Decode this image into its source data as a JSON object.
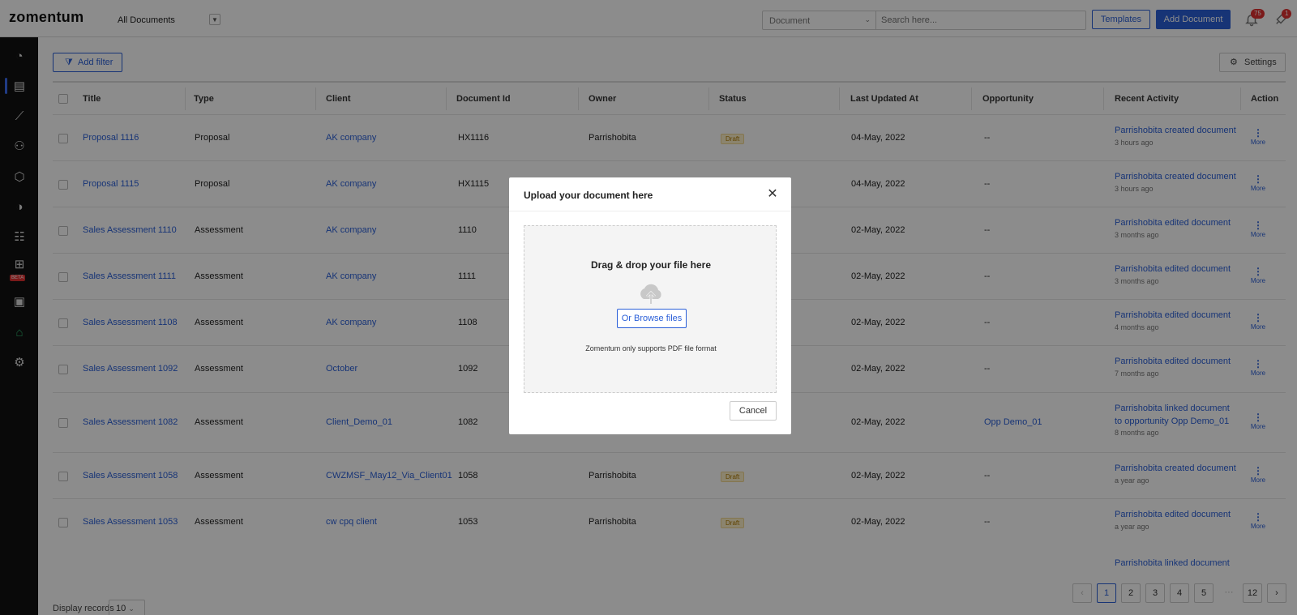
{
  "header": {
    "logo": "zomentum",
    "doc_filter": "All Documents",
    "search_type": "Document",
    "search_placeholder": "Search here...",
    "templates_label": "Templates",
    "add_document_label": "Add Document",
    "notifications_count": "75",
    "rocket_count": "1"
  },
  "sidebar": {
    "beta_label": "BETA"
  },
  "toolbar": {
    "add_filter_label": "Add filter",
    "settings_label": "Settings"
  },
  "table": {
    "headers": [
      "Title",
      "Type",
      "Client",
      "Document Id",
      "Owner",
      "Status",
      "Last Updated At",
      "Opportunity",
      "Recent Activity",
      "Action"
    ],
    "rows": [
      {
        "title": "Proposal 1116",
        "type": "Proposal",
        "client": "AK company",
        "doc_id": "HX1116",
        "owner": "Parrishobita",
        "status": "Draft",
        "updated": "04-May, 2022",
        "opportunity": "--",
        "activity": "Parrishobita created document",
        "ago": "3 hours ago",
        "more": "More"
      },
      {
        "title": "Proposal 1115",
        "type": "Proposal",
        "client": "AK company",
        "doc_id": "HX1115",
        "owner": "",
        "status": "",
        "updated": "04-May, 2022",
        "opportunity": "--",
        "activity": "Parrishobita created document",
        "ago": "3 hours ago",
        "more": "More"
      },
      {
        "title": "Sales Assessment 1110",
        "type": "Assessment",
        "client": "AK company",
        "doc_id": "1110",
        "owner": "",
        "status": "",
        "updated": "02-May, 2022",
        "opportunity": "--",
        "activity": "Parrishobita edited document",
        "ago": "3 months ago",
        "more": "More"
      },
      {
        "title": "Sales Assessment 1111",
        "type": "Assessment",
        "client": "AK company",
        "doc_id": "1111",
        "owner": "",
        "status": "",
        "updated": "02-May, 2022",
        "opportunity": "--",
        "activity": "Parrishobita edited document",
        "ago": "3 months ago",
        "more": "More"
      },
      {
        "title": "Sales Assessment 1108",
        "type": "Assessment",
        "client": "AK company",
        "doc_id": "1108",
        "owner": "",
        "status": "",
        "updated": "02-May, 2022",
        "opportunity": "--",
        "activity": "Parrishobita edited document",
        "ago": "4 months ago",
        "more": "More"
      },
      {
        "title": "Sales Assessment 1092",
        "type": "Assessment",
        "client": "October",
        "doc_id": "1092",
        "owner": "",
        "status": "",
        "updated": "02-May, 2022",
        "opportunity": "--",
        "activity": "Parrishobita edited document",
        "ago": "7 months ago",
        "more": "More"
      },
      {
        "title": "Sales Assessment 1082",
        "type": "Assessment",
        "client": "Client_Demo_01",
        "doc_id": "1082",
        "owner": "",
        "status": "",
        "updated": "02-May, 2022",
        "opportunity": "Opp Demo_01",
        "activity": "Parrishobita linked document to opportunity Opp Demo_01",
        "ago": "8 months ago",
        "more": "More"
      },
      {
        "title": "Sales Assessment 1058",
        "type": "Assessment",
        "client": "CWZMSF_May12_Via_Client01",
        "doc_id": "1058",
        "owner": "Parrishobita",
        "status": "Draft",
        "updated": "02-May, 2022",
        "opportunity": "--",
        "activity": "Parrishobita created document",
        "ago": "a year ago",
        "more": "More"
      },
      {
        "title": "Sales Assessment 1053",
        "type": "Assessment",
        "client": "cw cpq client",
        "doc_id": "1053",
        "owner": "Parrishobita",
        "status": "Draft",
        "updated": "02-May, 2022",
        "opportunity": "--",
        "activity": "Parrishobita edited document",
        "ago": "a year ago",
        "more": "More"
      }
    ],
    "partial_activity": "Parrishobita linked document"
  },
  "footer": {
    "display_label": "Display records",
    "display_value": "10",
    "pages": [
      "1",
      "2",
      "3",
      "4",
      "5"
    ],
    "ellipsis": "···",
    "last_page": "12",
    "prev": "‹",
    "next": "›"
  },
  "modal": {
    "title": "Upload your document here",
    "drop_title": "Drag & drop your file here",
    "browse_label": "Or Browse files",
    "note": "Zomentum only supports PDF file format",
    "cancel_label": "Cancel",
    "close_glyph": "✕"
  },
  "colors": {
    "accent": "#2a5fd8",
    "sidebar_bg": "#111111",
    "badge": "#e03131",
    "draft_text": "#b07a00"
  }
}
